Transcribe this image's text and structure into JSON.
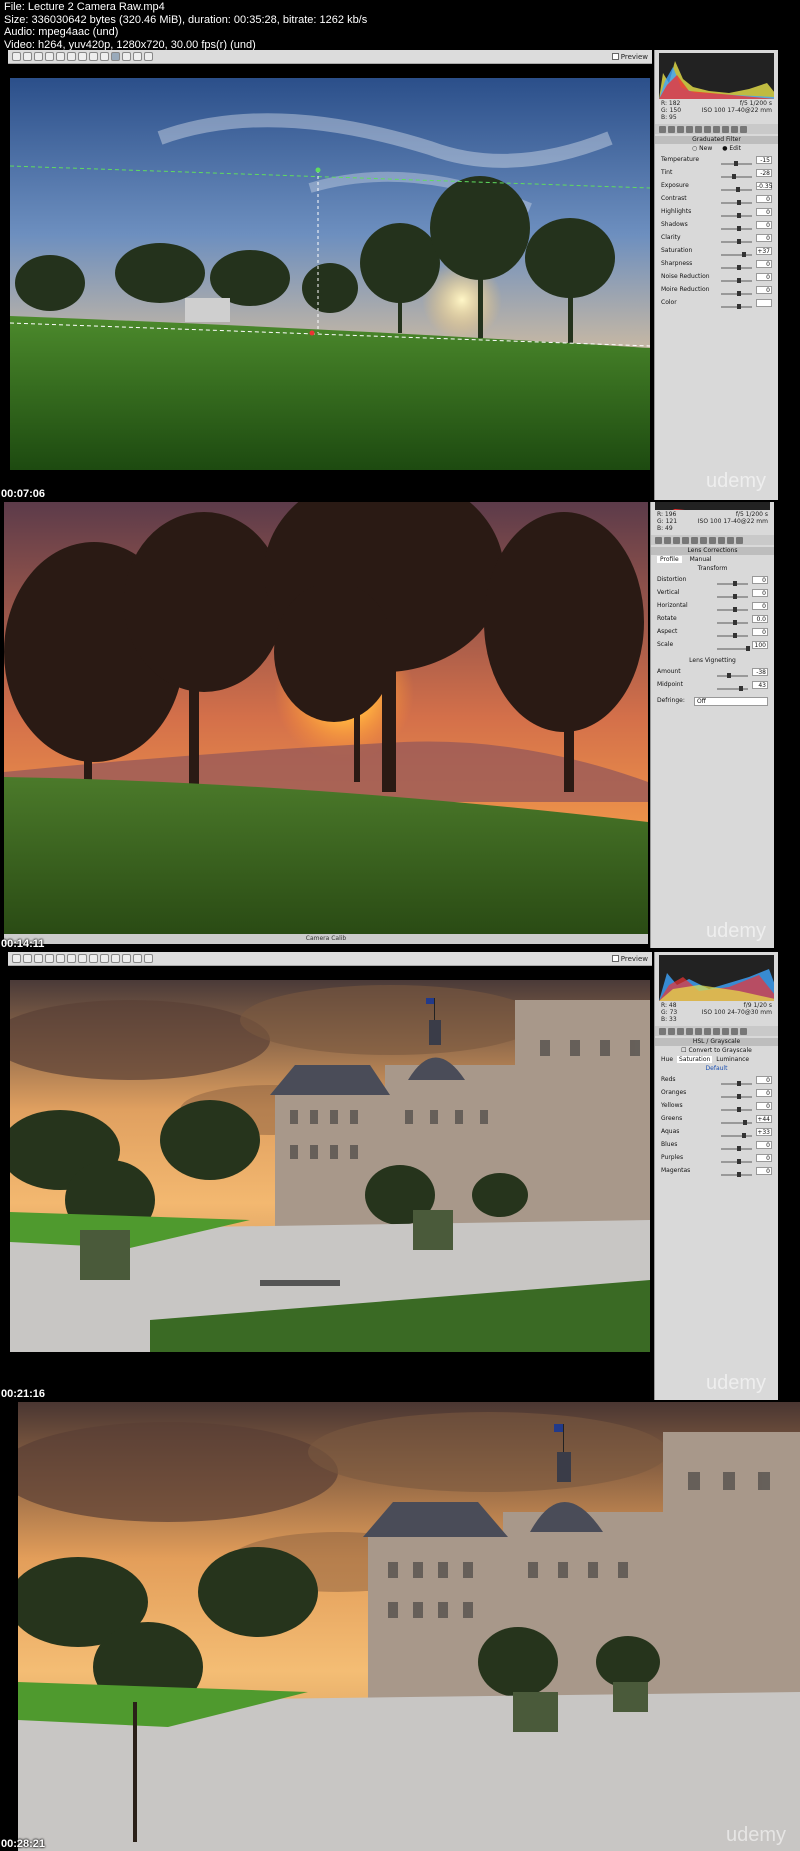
{
  "header": {
    "file": "File: Lecture 2 Camera Raw.mp4",
    "size": "Size: 336030642 bytes (320.46 MiB), duration: 00:35:28, bitrate: 1262 kb/s",
    "audio": "Audio: mpeg4aac (und)",
    "video": "Video: h264, yuv420p, 1280x720, 30.00 fps(r) (und)"
  },
  "watermark": "udemy",
  "frames": [
    {
      "timestamp": "00:07:06",
      "preview_label": "Preview",
      "readout": {
        "r": "R: 182",
        "g": "G: 150",
        "b": "B: 95",
        "exposure": "f/5  1/200 s",
        "iso": "ISO 100  17-40@22 mm"
      },
      "panel_title": "Graduated Filter",
      "modes": {
        "new": "New",
        "edit": "Edit"
      },
      "sliders": [
        {
          "label": "Temperature",
          "value": "-15"
        },
        {
          "label": "Tint",
          "value": "-28"
        },
        {
          "label": "Exposure",
          "value": "-0.35"
        },
        {
          "label": "Contrast",
          "value": "0"
        },
        {
          "label": "Highlights",
          "value": "0"
        },
        {
          "label": "Shadows",
          "value": "0"
        },
        {
          "label": "Clarity",
          "value": "0"
        },
        {
          "label": "Saturation",
          "value": "+37"
        },
        {
          "label": "Sharpness",
          "value": "0"
        },
        {
          "label": "Noise Reduction",
          "value": "0"
        },
        {
          "label": "Moire Reduction",
          "value": "0"
        },
        {
          "label": "Color",
          "value": ""
        }
      ]
    },
    {
      "timestamp": "00:14:11",
      "readout": {
        "r": "R: 196",
        "g": "G: 121",
        "b": "B: 49",
        "exposure": "f/5  1/200 s",
        "iso": "ISO 100  17-40@22 mm"
      },
      "tabs": {
        "profile": "Profile",
        "manual": "Manual"
      },
      "panel_title": "Lens Corrections",
      "section_transform": "Transform",
      "sliders": [
        {
          "label": "Distortion",
          "value": "0"
        },
        {
          "label": "Vertical",
          "value": "0"
        },
        {
          "label": "Horizontal",
          "value": "0"
        },
        {
          "label": "Rotate",
          "value": "0.0"
        },
        {
          "label": "Aspect",
          "value": "0"
        },
        {
          "label": "Scale",
          "value": "100"
        }
      ],
      "section_vignetting": "Lens Vignetting",
      "vignette": [
        {
          "label": "Amount",
          "value": "-38"
        },
        {
          "label": "Midpoint",
          "value": "43"
        }
      ],
      "defringe": {
        "label": "Defringe:",
        "value": "Off"
      },
      "bottom_bar": "Camera Calib"
    },
    {
      "timestamp": "00:21:16",
      "preview_label": "Preview",
      "readout": {
        "r": "R: 48",
        "g": "G: 73",
        "b": "B: 33",
        "exposure": "f/9  1/20 s",
        "iso": "ISO 100  24-70@30 mm"
      },
      "panel_title": "HSL / Grayscale",
      "convert_label": "Convert to Grayscale",
      "tabs": {
        "hue": "Hue",
        "saturation": "Saturation",
        "luminance": "Luminance"
      },
      "default_link": "Default",
      "sliders": [
        {
          "label": "Reds",
          "value": "0"
        },
        {
          "label": "Oranges",
          "value": "0"
        },
        {
          "label": "Yellows",
          "value": "0"
        },
        {
          "label": "Greens",
          "value": "+44"
        },
        {
          "label": "Aquas",
          "value": "+33"
        },
        {
          "label": "Blues",
          "value": "0"
        },
        {
          "label": "Purples",
          "value": "0"
        },
        {
          "label": "Magentas",
          "value": "0"
        }
      ]
    },
    {
      "timestamp": "00:28:21"
    }
  ]
}
